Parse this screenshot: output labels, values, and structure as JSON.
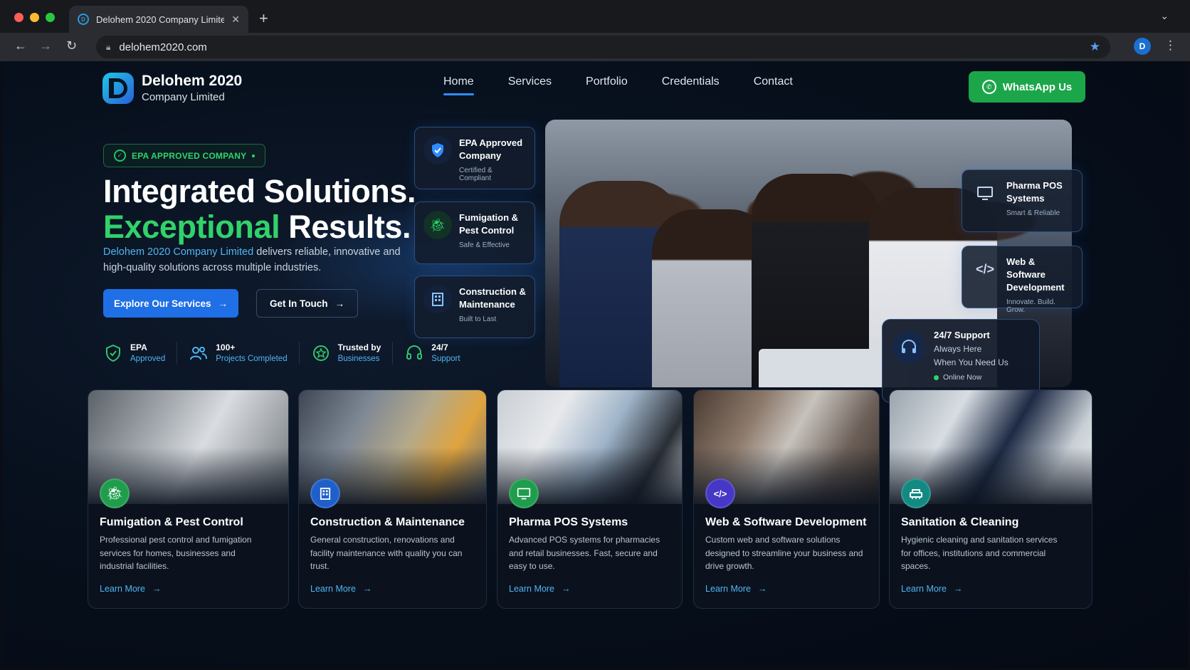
{
  "browser": {
    "tab_title": "Delohem 2020 Company Limite",
    "url": "delohem2020.com",
    "profile_initial": "D"
  },
  "header": {
    "brand_name": "Delohem 2020",
    "brand_sub": "Company Limited",
    "nav": [
      "Home",
      "Services",
      "Portfolio",
      "Credentials",
      "Contact"
    ],
    "active_nav": "Home",
    "cta_label": "WhatsApp Us"
  },
  "hero": {
    "badge": "EPA APPROVED COMPANY",
    "headline_line1": "Integrated Solutions.",
    "headline_accent": "Exceptional",
    "headline_rest": "Results.",
    "intro_brand": "Delohem 2020 Company Limited",
    "intro_rest": "delivers reliable, innovative and high-quality solutions across multiple industries.",
    "primary_btn": "Explore Our Services",
    "secondary_btn": "Get In Touch",
    "stats": [
      {
        "title": "EPA",
        "sub": "Approved",
        "icon": "shield-check-icon"
      },
      {
        "title": "100+",
        "sub": "Projects Completed",
        "icon": "users-icon"
      },
      {
        "title": "Trusted by",
        "sub": "Businesses",
        "icon": "star-badge-icon"
      },
      {
        "title": "24/7",
        "sub": "Support",
        "icon": "headset-icon"
      }
    ]
  },
  "feature_cards": [
    {
      "title": "EPA Approved Company",
      "sub": "Certified & Compliant",
      "icon": "shield-icon"
    },
    {
      "title": "Fumigation & Pest Control",
      "sub": "Safe & Effective",
      "icon": "bug-icon"
    },
    {
      "title": "Construction & Maintenance",
      "sub": "Built to Last",
      "icon": "building-icon"
    },
    {
      "title": "Pharma POS Systems",
      "sub": "Smart & Reliable",
      "icon": "monitor-icon"
    },
    {
      "title": "Web & Software Development",
      "sub": "Innovate. Build. Grow.",
      "icon": "code-icon"
    }
  ],
  "support": {
    "title": "24/7 Support",
    "line1": "Always Here",
    "line2": "When You Need Us",
    "status": "Online Now"
  },
  "services": [
    {
      "title": "Fumigation & Pest Control",
      "desc": "Professional pest control and fumigation services for homes, businesses and industrial facilities.",
      "link": "Learn More",
      "icon": "bug-icon",
      "color": "#1f9d4c"
    },
    {
      "title": "Construction & Maintenance",
      "desc": "General construction, renovations and facility maintenance with quality you can trust.",
      "link": "Learn More",
      "icon": "building-icon",
      "color": "#1f5fc9"
    },
    {
      "title": "Pharma POS Systems",
      "desc": "Advanced POS systems for pharmacies and retail businesses. Fast, secure and easy to use.",
      "link": "Learn More",
      "icon": "monitor-icon",
      "color": "#1f9d4c"
    },
    {
      "title": "Web & Software Development",
      "desc": "Custom web and software solutions designed to streamline your business and drive growth.",
      "link": "Learn More",
      "icon": "code-icon",
      "color": "#4737c7"
    },
    {
      "title": "Sanitation & Cleaning",
      "desc": "Hygienic cleaning and sanitation services for offices, institutions and commercial spaces.",
      "link": "Learn More",
      "icon": "cleaning-icon",
      "color": "#128a82"
    }
  ],
  "colors": {
    "accent_green": "#31d26a",
    "accent_blue": "#1f6fe6",
    "link_blue": "#4fb6f2",
    "whatsapp_green": "#1ca64a"
  }
}
